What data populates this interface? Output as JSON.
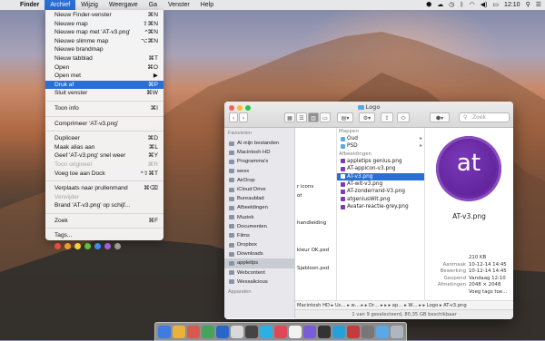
{
  "menubar": {
    "apple": "",
    "items": [
      "Finder",
      "Archief",
      "Wijzig",
      "Weergave",
      "Ga",
      "Venster",
      "Help"
    ],
    "clock": "12:10"
  },
  "archief_menu": {
    "items": [
      {
        "label": "Nieuw Finder-venster",
        "shortcut": "⌘N",
        "disabled": false
      },
      {
        "label": "Nieuwe map",
        "shortcut": "⇧⌘N",
        "disabled": false
      },
      {
        "label": "Nieuwe map met 'AT-v3.png'",
        "shortcut": "^⌘N",
        "disabled": false
      },
      {
        "label": "Nieuwe slimme map",
        "shortcut": "⌥⌘N",
        "disabled": false
      },
      {
        "label": "Nieuwe brandmap",
        "shortcut": "",
        "disabled": false
      },
      {
        "label": "Nieuw tabblad",
        "shortcut": "⌘T",
        "disabled": false
      },
      {
        "label": "Open",
        "shortcut": "⌘O",
        "disabled": false
      },
      {
        "label": "Open met",
        "shortcut": "▶",
        "disabled": false
      },
      {
        "label": "Druk af",
        "shortcut": "⌘P",
        "disabled": false,
        "highlight": true
      },
      {
        "label": "Sluit venster",
        "shortcut": "⌘W",
        "disabled": false
      },
      {
        "sep": true
      },
      {
        "label": "Toon info",
        "shortcut": "⌘I",
        "disabled": false
      },
      {
        "sep": true
      },
      {
        "label": "Comprimeer 'AT-v3.png'",
        "shortcut": "",
        "disabled": false
      },
      {
        "sep": true
      },
      {
        "label": "Dupliceer",
        "shortcut": "⌘D",
        "disabled": false
      },
      {
        "label": "Maak alias aan",
        "shortcut": "⌘L",
        "disabled": false
      },
      {
        "label": "Geef 'AT-v3.png' snel weer",
        "shortcut": "⌘Y",
        "disabled": false
      },
      {
        "label": "Toon origineel",
        "shortcut": "⌘R",
        "disabled": true
      },
      {
        "label": "Voeg toe aan Dock",
        "shortcut": "^⇧⌘T",
        "disabled": false
      },
      {
        "sep": true
      },
      {
        "label": "Verplaats naar prullenmand",
        "shortcut": "⌘⌫",
        "disabled": false
      },
      {
        "label": "Verwijder",
        "shortcut": "",
        "disabled": true
      },
      {
        "label": "Brand 'AT-v3.png' op schijf...",
        "shortcut": "",
        "disabled": false
      },
      {
        "sep": true
      },
      {
        "label": "Zoek",
        "shortcut": "⌘F",
        "disabled": false
      },
      {
        "sep": true
      },
      {
        "label": "Tags...",
        "shortcut": "",
        "disabled": false
      }
    ],
    "tag_colors": [
      "#e94b3c",
      "#f39a2e",
      "#f5cf32",
      "#5cc23a",
      "#3d8bf2",
      "#a262d6",
      "#9a9a9a"
    ]
  },
  "window": {
    "title": "Logo",
    "search_placeholder": "Zoek",
    "sidebar": {
      "favorites_header": "Favorieten",
      "items": [
        "Al mijn bestanden",
        "Macintosh HD",
        "Programma's",
        "wesx",
        "AirDrop",
        "iCloud Drive",
        "Bureaublad",
        "Afbeeldingen",
        "Muziek",
        "Documenten",
        "Films",
        "Dropbox",
        "Downloads",
        "appletips",
        "Webcontent",
        "Wesxalicious"
      ],
      "selected_index": 13,
      "devices_header": "Apparaten"
    },
    "column1": [
      "",
      "",
      "",
      "",
      "",
      "",
      "r icons",
      "ot",
      "",
      "",
      "handleiding",
      "",
      "",
      "kleur OK.psd",
      "",
      "Sjabloon.psd"
    ],
    "column2": {
      "header_folders": "Mappen",
      "folders": [
        "Oud",
        "PSD"
      ],
      "header_images": "Afbeeldingen",
      "files": [
        "appletips genius.png",
        "AT-appicon-v3.png",
        "AT-v3.png",
        "AT-wit-v3.png",
        "AT-zonderrand-V3.png",
        "atgeniusWit.png",
        "Avatar-reactie-grey.png"
      ],
      "selected_index": 2
    },
    "preview": {
      "logo_text": "at",
      "filename": "AT-v3.png",
      "size": "210 KB",
      "meta": [
        {
          "k": "Aanmaak",
          "v": "10-12-14 14:45"
        },
        {
          "k": "Bewerking",
          "v": "10-12-14 14:45"
        },
        {
          "k": "Geopend",
          "v": "Vandaag 12:10"
        },
        {
          "k": "Afmetingen",
          "v": "2048 × 2048"
        }
      ],
      "tags_link": "Voeg tags toe..."
    },
    "pathbar": "Macintosh HD  ▸  Us…  ▸  w…  ▸  ▸ Dr…  ▸  ▸  ▸ ap…  ▸  W…  ▸  ▸  Logo  ▸  AT-v3.png",
    "status": "1 van 9 geselecteerd, 80,35 GB beschikbaar"
  },
  "dock_colors": [
    "#3f7be0",
    "#e8b33a",
    "#d85a4f",
    "#46a35a",
    "#2a66c9",
    "#d9d9d9",
    "#444",
    "#2ab0e5",
    "#e0485a",
    "#f2f2f2",
    "#7a5bd8",
    "#333",
    "#26a0d8",
    "#c33b3b",
    "#777",
    "#5aa9e6",
    "#b0b6c0"
  ]
}
